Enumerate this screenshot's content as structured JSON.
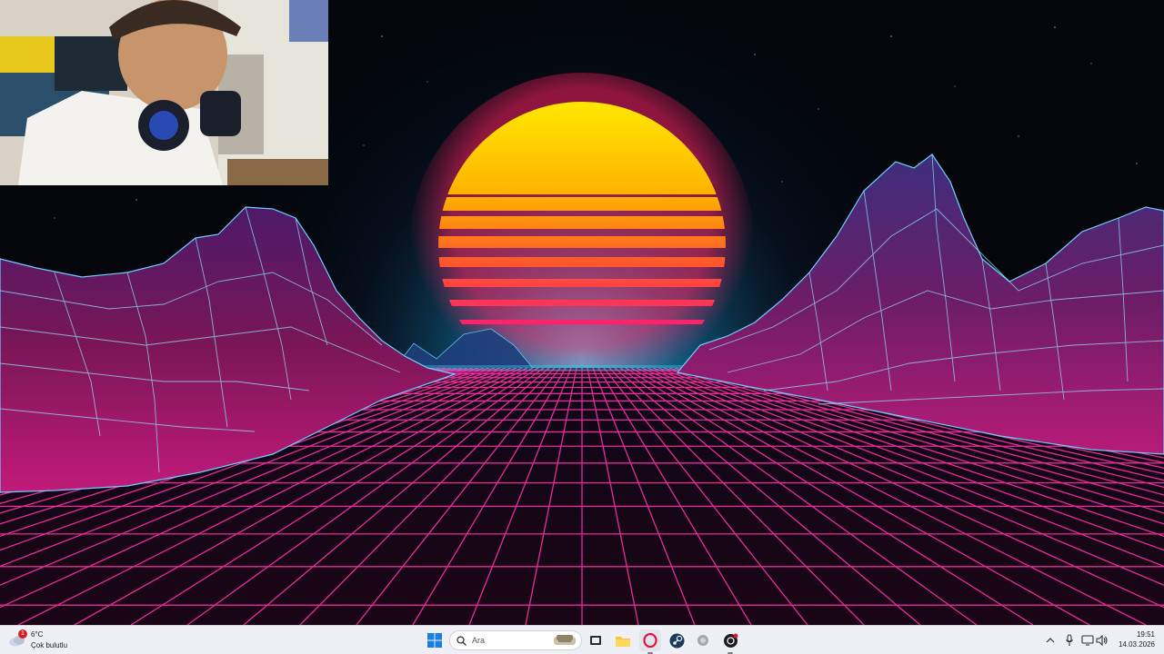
{
  "taskbar": {
    "weather": {
      "temperature": "6°C",
      "description": "Çok bulutlu",
      "badge_count": "1"
    },
    "search": {
      "placeholder": "Ara"
    },
    "clock": {
      "time": "19:51",
      "date": "14.03.2026"
    },
    "pinned_apps": [
      "start-icon",
      "search-icon",
      "widget-icon",
      "task-view-icon",
      "file-explorer-icon",
      "opera-icon",
      "steam-icon",
      "app-icon",
      "app-icon"
    ],
    "tray_icons": [
      "chevron-up-icon",
      "microphone-icon",
      "display-icon",
      "speaker-icon"
    ]
  },
  "colors": {
    "sun_top": "#ffe600",
    "sun_bottom": "#ff1f5e",
    "grid": "#ff2fa8",
    "mountain_glow": "#48b9ff",
    "horizon": "#2ad4ff",
    "taskbar_bg": "#eef0f5"
  }
}
